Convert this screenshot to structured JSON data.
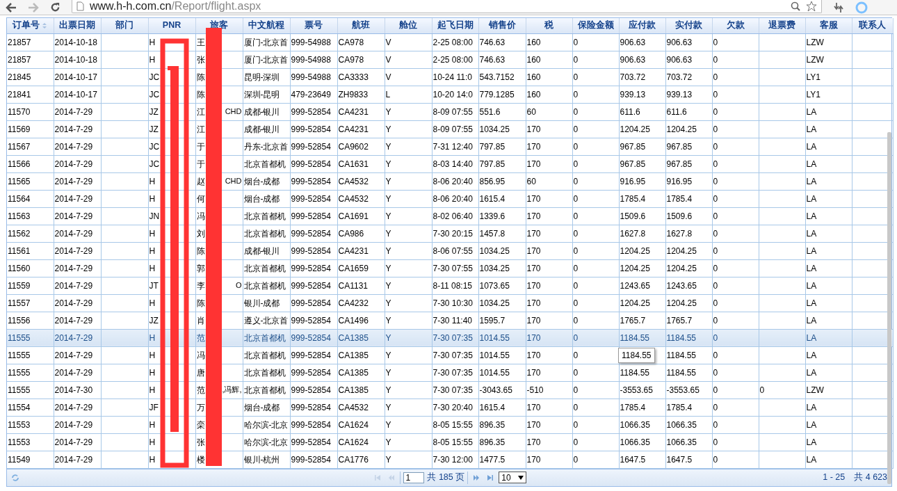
{
  "browser": {
    "url_host": "www.h-h.com.cn",
    "url_path": "/Report/flight.aspx"
  },
  "columns": [
    {
      "label": "订单号",
      "sortable": true
    },
    {
      "label": "出票日期",
      "sortable": false
    },
    {
      "label": "部门",
      "sortable": false
    },
    {
      "label": "PNR",
      "sortable": false
    },
    {
      "label": "旅客",
      "sortable": false
    },
    {
      "label": "中文航程",
      "sortable": false
    },
    {
      "label": "票号",
      "sortable": false
    },
    {
      "label": "航班",
      "sortable": false
    },
    {
      "label": "舱位",
      "sortable": false
    },
    {
      "label": "起飞日期",
      "sortable": false
    },
    {
      "label": "销售价",
      "sortable": false
    },
    {
      "label": "税",
      "sortable": false
    },
    {
      "label": "保险金额",
      "sortable": false
    },
    {
      "label": "应付款",
      "sortable": false
    },
    {
      "label": "实付款",
      "sortable": false
    },
    {
      "label": "欠款",
      "sortable": false
    },
    {
      "label": "退票费",
      "sortable": false
    },
    {
      "label": "客服",
      "sortable": false
    },
    {
      "label": "联系人",
      "sortable": false
    }
  ],
  "rows": [
    {
      "selected": false,
      "order_no": "21857",
      "issue_date": "2014-10-18",
      "pnr": "H",
      "passenger": "王",
      "route": "厦门-北京首",
      "ticket_no": "999-54988",
      "flight": "CA978",
      "cabin": "V",
      "departure": "2-25 08:00",
      "sale_price": "746.63",
      "tax": "160",
      "insurance": "0",
      "payable": "906.63",
      "paid": "906.63",
      "owed": "0",
      "agent": "LZW"
    },
    {
      "selected": false,
      "order_no": "21857",
      "issue_date": "2014-10-18",
      "pnr": "H",
      "passenger": "张",
      "route": "厦门-北京首",
      "ticket_no": "999-54988",
      "flight": "CA978",
      "cabin": "V",
      "departure": "2-25 08:00",
      "sale_price": "746.63",
      "tax": "160",
      "insurance": "0",
      "payable": "906.63",
      "paid": "906.63",
      "owed": "0",
      "agent": "LZW"
    },
    {
      "selected": false,
      "order_no": "21845",
      "issue_date": "2014-10-17",
      "pnr": "JC",
      "passenger": "陈",
      "route": "昆明-深圳",
      "ticket_no": "999-54988",
      "flight": "CA3333",
      "cabin": "V",
      "departure": "10-24 11:0",
      "sale_price": "543.7152",
      "tax": "160",
      "insurance": "0",
      "payable": "703.72",
      "paid": "703.72",
      "owed": "0",
      "agent": "LY1"
    },
    {
      "selected": false,
      "order_no": "21841",
      "issue_date": "2014-10-17",
      "pnr": "JC",
      "passenger": "陈",
      "route": "深圳-昆明",
      "ticket_no": "479-23649",
      "flight": "ZH9833",
      "cabin": "L",
      "departure": "10-20 14:0",
      "sale_price": "779.1285",
      "tax": "160",
      "insurance": "0",
      "payable": "939.13",
      "paid": "939.13",
      "owed": "0",
      "agent": "LY1"
    },
    {
      "selected": false,
      "order_no": "11570",
      "issue_date": "2014-7-29",
      "pnr": "JZ",
      "passenger": "江",
      "passenger_note": "CHD",
      "route": "成都-银川",
      "ticket_no": "999-52854",
      "flight": "CA4231",
      "cabin": "Y",
      "departure": "8-09 07:55",
      "sale_price": "551.6",
      "tax": "60",
      "insurance": "0",
      "payable": "611.6",
      "paid": "611.6",
      "owed": "0",
      "agent": "LA"
    },
    {
      "selected": false,
      "order_no": "11569",
      "issue_date": "2014-7-29",
      "pnr": "JZ",
      "passenger": "江",
      "route": "成都-银川",
      "ticket_no": "999-52854",
      "flight": "CA4231",
      "cabin": "Y",
      "departure": "8-09 07:55",
      "sale_price": "1034.25",
      "tax": "170",
      "insurance": "0",
      "payable": "1204.25",
      "paid": "1204.25",
      "owed": "0",
      "agent": "LA"
    },
    {
      "selected": false,
      "order_no": "11567",
      "issue_date": "2014-7-29",
      "pnr": "JC",
      "passenger": "于",
      "route": "丹东-北京首",
      "ticket_no": "999-52854",
      "flight": "CA9602",
      "cabin": "Y",
      "departure": "7-31 12:40",
      "sale_price": "797.85",
      "tax": "170",
      "insurance": "0",
      "payable": "967.85",
      "paid": "967.85",
      "owed": "0",
      "agent": "LA"
    },
    {
      "selected": false,
      "order_no": "11566",
      "issue_date": "2014-7-29",
      "pnr": "JC",
      "passenger": "于",
      "route": "北京首都机",
      "ticket_no": "999-52854",
      "flight": "CA1631",
      "cabin": "Y",
      "departure": "8-03 14:40",
      "sale_price": "797.85",
      "tax": "170",
      "insurance": "0",
      "payable": "967.85",
      "paid": "967.85",
      "owed": "0",
      "agent": "LA"
    },
    {
      "selected": false,
      "order_no": "11565",
      "issue_date": "2014-7-29",
      "pnr": "H",
      "passenger": "赵",
      "passenger_note": "CHD",
      "route": "烟台-成都",
      "ticket_no": "999-52854",
      "flight": "CA4532",
      "cabin": "Y",
      "departure": "8-06 20:40",
      "sale_price": "856.95",
      "tax": "60",
      "insurance": "0",
      "payable": "916.95",
      "paid": "916.95",
      "owed": "0",
      "agent": "LA"
    },
    {
      "selected": false,
      "order_no": "11564",
      "issue_date": "2014-7-29",
      "pnr": "H",
      "passenger": "何",
      "route": "烟台-成都",
      "ticket_no": "999-52854",
      "flight": "CA4532",
      "cabin": "Y",
      "departure": "8-06 20:40",
      "sale_price": "1615.4",
      "tax": "170",
      "insurance": "0",
      "payable": "1785.4",
      "paid": "1785.4",
      "owed": "0",
      "agent": "LA"
    },
    {
      "selected": false,
      "order_no": "11563",
      "issue_date": "2014-7-29",
      "pnr": "JN",
      "passenger": "冯",
      "route": "北京首都机",
      "ticket_no": "999-52854",
      "flight": "CA1691",
      "cabin": "Y",
      "departure": "8-02 06:40",
      "sale_price": "1339.6",
      "tax": "170",
      "insurance": "0",
      "payable": "1509.6",
      "paid": "1509.6",
      "owed": "0",
      "agent": "LA"
    },
    {
      "selected": false,
      "order_no": "11562",
      "issue_date": "2014-7-29",
      "pnr": "H",
      "passenger": "刘",
      "route": "北京首都机",
      "ticket_no": "999-52854",
      "flight": "CA986",
      "cabin": "Y",
      "departure": "7-30 20:15",
      "sale_price": "1457.8",
      "tax": "170",
      "insurance": "0",
      "payable": "1627.8",
      "paid": "1627.8",
      "owed": "0",
      "agent": "LA"
    },
    {
      "selected": false,
      "order_no": "11561",
      "issue_date": "2014-7-29",
      "pnr": "H",
      "passenger": "陈",
      "route": "成都-银川",
      "ticket_no": "999-52854",
      "flight": "CA4231",
      "cabin": "Y",
      "departure": "8-06 07:55",
      "sale_price": "1034.25",
      "tax": "170",
      "insurance": "0",
      "payable": "1204.25",
      "paid": "1204.25",
      "owed": "0",
      "agent": "LA"
    },
    {
      "selected": false,
      "order_no": "11560",
      "issue_date": "2014-7-29",
      "pnr": "H",
      "passenger": "郭",
      "route": "北京首都机",
      "ticket_no": "999-52854",
      "flight": "CA1659",
      "cabin": "Y",
      "departure": "7-30 07:55",
      "sale_price": "1034.25",
      "tax": "170",
      "insurance": "0",
      "payable": "1204.25",
      "paid": "1204.25",
      "owed": "0",
      "agent": "LA"
    },
    {
      "selected": false,
      "order_no": "11559",
      "issue_date": "2014-7-29",
      "pnr": "JT",
      "passenger": "李",
      "passenger_note": "O",
      "route": "北京首都机",
      "ticket_no": "999-52854",
      "flight": "CA1131",
      "cabin": "Y",
      "departure": "8-11 08:15",
      "sale_price": "1073.65",
      "tax": "170",
      "insurance": "0",
      "payable": "1243.65",
      "paid": "1243.65",
      "owed": "0",
      "agent": "LA"
    },
    {
      "selected": false,
      "order_no": "11557",
      "issue_date": "2014-7-29",
      "pnr": "H",
      "passenger": "陈",
      "route": "银川-成都",
      "ticket_no": "999-52854",
      "flight": "CA4232",
      "cabin": "Y",
      "departure": "7-30 10:30",
      "sale_price": "1034.25",
      "tax": "170",
      "insurance": "0",
      "payable": "1204.25",
      "paid": "1204.25",
      "owed": "0",
      "agent": "LA"
    },
    {
      "selected": false,
      "order_no": "11556",
      "issue_date": "2014-7-29",
      "pnr": "JZ",
      "passenger": "肖",
      "route": "遵义-北京首",
      "ticket_no": "999-52854",
      "flight": "CA1496",
      "cabin": "Y",
      "departure": "7-30 11:40",
      "sale_price": "1595.7",
      "tax": "170",
      "insurance": "0",
      "payable": "1765.7",
      "paid": "1765.7",
      "owed": "0",
      "agent": "LA"
    },
    {
      "selected": true,
      "order_no": "11555",
      "issue_date": "2014-7-29",
      "pnr": "H",
      "passenger": "范",
      "route": "北京首都机",
      "ticket_no": "999-52854",
      "flight": "CA1385",
      "cabin": "Y",
      "departure": "7-30 07:35",
      "sale_price": "1014.55",
      "tax": "170",
      "insurance": "0",
      "payable": "1184.55",
      "paid": "1184.55",
      "owed": "0",
      "agent": "LA"
    },
    {
      "selected": false,
      "order_no": "11555",
      "issue_date": "2014-7-29",
      "pnr": "H",
      "passenger": "冯",
      "route": "北京首都机",
      "ticket_no": "999-52854",
      "flight": "CA1385",
      "cabin": "Y",
      "departure": "7-30 07:35",
      "sale_price": "1014.55",
      "tax": "170",
      "insurance": "0",
      "paid": "1184.55",
      "owed": "0",
      "agent": "LA"
    },
    {
      "selected": false,
      "order_no": "11555",
      "issue_date": "2014-7-29",
      "pnr": "H",
      "passenger": "唐",
      "route": "北京首都机",
      "ticket_no": "999-52854",
      "flight": "CA1385",
      "cabin": "Y",
      "departure": "7-30 07:35",
      "sale_price": "1014.55",
      "tax": "170",
      "insurance": "0",
      "payable": "1184.55",
      "paid": "1184.55",
      "owed": "0",
      "agent": "LA"
    },
    {
      "selected": false,
      "order_no": "11555",
      "issue_date": "2014-7-30",
      "pnr": "H",
      "passenger": "范",
      "passenger_note": ",冯辉,",
      "route": "北京首都机",
      "ticket_no": "999-52854",
      "flight": "CA1385",
      "cabin": "Y",
      "departure": "7-30 07:35",
      "sale_price": "-3043.65",
      "tax": "-510",
      "insurance": "0",
      "payable": "-3553.65",
      "paid": "-3553.65",
      "owed": "0",
      "refund_fee": "0",
      "agent": "LZW"
    },
    {
      "selected": false,
      "order_no": "11554",
      "issue_date": "2014-7-29",
      "pnr": "JF",
      "passenger": "万",
      "route": "烟台-成都",
      "ticket_no": "999-52854",
      "flight": "CA4532",
      "cabin": "Y",
      "departure": "7-30 20:40",
      "sale_price": "1615.4",
      "tax": "170",
      "insurance": "0",
      "payable": "1785.4",
      "paid": "1785.4",
      "owed": "0",
      "agent": "LA"
    },
    {
      "selected": false,
      "order_no": "11553",
      "issue_date": "2014-7-29",
      "pnr": "H",
      "passenger": "栾",
      "route": "哈尔滨-北京",
      "ticket_no": "999-52854",
      "flight": "CA1624",
      "cabin": "Y",
      "departure": "8-05 15:55",
      "sale_price": "896.35",
      "tax": "170",
      "insurance": "0",
      "payable": "1066.35",
      "paid": "1066.35",
      "owed": "0",
      "agent": "LA"
    },
    {
      "selected": false,
      "order_no": "11553",
      "issue_date": "2014-7-29",
      "pnr": "H",
      "passenger": "张",
      "route": "哈尔滨-北京",
      "ticket_no": "999-52854",
      "flight": "CA1624",
      "cabin": "Y",
      "departure": "8-05 15:55",
      "sale_price": "896.35",
      "tax": "170",
      "insurance": "0",
      "payable": "1066.35",
      "paid": "1066.35",
      "owed": "0",
      "agent": "LA"
    },
    {
      "selected": false,
      "order_no": "11549",
      "issue_date": "2014-7-29",
      "pnr": "H",
      "passenger": "楼",
      "route": "银川-杭州",
      "ticket_no": "999-52854",
      "flight": "CA1776",
      "cabin": "Y",
      "departure": "7-30 12:00",
      "sale_price": "1477.5",
      "tax": "170",
      "insurance": "0",
      "payable": "1647.5",
      "paid": "1647.5",
      "owed": "0",
      "agent": "LA"
    }
  ],
  "tooltip": {
    "text": "1184.55"
  },
  "pager": {
    "first_disabled": true,
    "prev_disabled": true,
    "page": "1",
    "total_pages": "共 185 页",
    "next_disabled": false,
    "last_disabled": false,
    "page_size": "10",
    "summary": "1 - 25　共 4 623"
  }
}
